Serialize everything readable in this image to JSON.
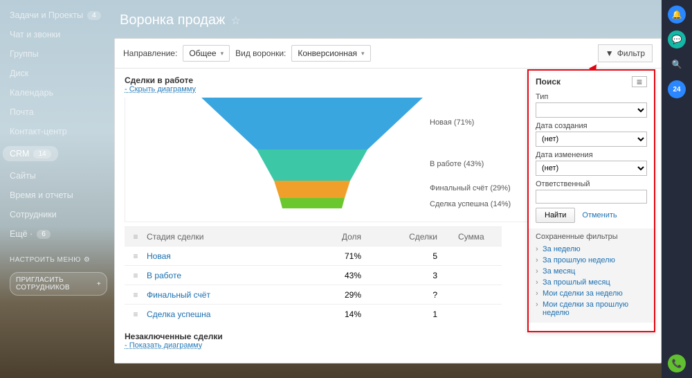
{
  "sidebar": {
    "items": [
      {
        "label": "Задачи и Проекты",
        "badge": "4"
      },
      {
        "label": "Чат и звонки"
      },
      {
        "label": "Группы"
      },
      {
        "label": "Диск"
      },
      {
        "label": "Календарь"
      },
      {
        "label": "Почта"
      },
      {
        "label": "Контакт-центр"
      },
      {
        "label": "CRM",
        "badge": "14",
        "active": true
      },
      {
        "label": "Сайты"
      },
      {
        "label": "Время и отчеты"
      },
      {
        "label": "Сотрудники"
      },
      {
        "label": "Ещё ·",
        "badge": "6"
      }
    ],
    "config_label": "НАСТРОИТЬ МЕНЮ",
    "invite_label": "ПРИГЛАСИТЬ СОТРУДНИКОВ"
  },
  "page": {
    "title": "Воронка продаж"
  },
  "toolbar": {
    "direction_label": "Направление:",
    "direction_value": "Общее",
    "funnel_type_label": "Вид воронки:",
    "funnel_type_value": "Конверсионная",
    "filter_label": "Фильтр"
  },
  "deals": {
    "title": "Сделки в работе",
    "hide_label": "- Скрыть диаграмму",
    "unclosed_title": "Незаключенные сделки",
    "show_label": "- Показать диаграмму"
  },
  "chart_data": {
    "type": "bar",
    "orientation": "funnel",
    "categories": [
      "Новая",
      "В работе",
      "Финальный счёт",
      "Сделка успешна"
    ],
    "values": [
      71,
      43,
      29,
      14
    ],
    "colors": [
      "#3aa6e0",
      "#3cc8a6",
      "#f0a02a",
      "#6bc72e"
    ],
    "unit": "%"
  },
  "table": {
    "columns": [
      "Стадия сделки",
      "Доля",
      "Сделки",
      "Сумма"
    ],
    "rows": [
      {
        "stage": "Новая",
        "share": "71%",
        "deals": "5"
      },
      {
        "stage": "В работе",
        "share": "43%",
        "deals": "3"
      },
      {
        "stage": "Финальный счёт",
        "share": "29%",
        "deals": "?"
      },
      {
        "stage": "Сделка успешна",
        "share": "14%",
        "deals": "1"
      }
    ]
  },
  "filter": {
    "title": "Поиск",
    "type_label": "Тип",
    "created_label": "Дата создания",
    "created_value": "(нет)",
    "modified_label": "Дата изменения",
    "modified_value": "(нет)",
    "resp_label": "Ответственный",
    "find_label": "Найти",
    "cancel_label": "Отменить",
    "saved_title": "Сохраненные фильтры",
    "saved": [
      "За неделю",
      "За прошлую неделю",
      "За месяц",
      "За прошлый месяц",
      "Мои сделки за неделю",
      "Мои сделки за прошлую неделю"
    ]
  },
  "rail": {
    "badge": "24"
  }
}
